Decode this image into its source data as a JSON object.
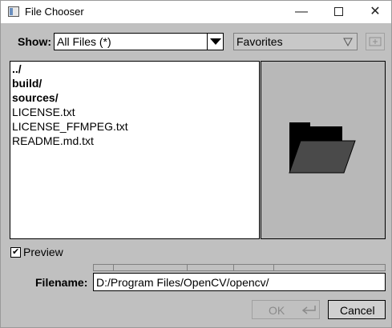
{
  "window": {
    "title": "File Chooser",
    "minimize": "—",
    "close": "✕"
  },
  "filter": {
    "label": "Show:",
    "value": "All Files (*)"
  },
  "favorites": {
    "value": "Favorites"
  },
  "files": [
    {
      "name": "../",
      "is_dir": true
    },
    {
      "name": "build/",
      "is_dir": true
    },
    {
      "name": "sources/",
      "is_dir": true
    },
    {
      "name": "LICENSE.txt",
      "is_dir": false
    },
    {
      "name": "LICENSE_FFMPEG.txt",
      "is_dir": false
    },
    {
      "name": "README.md.txt",
      "is_dir": false
    }
  ],
  "preview": {
    "label": "Preview",
    "checked": true,
    "icon": "folder-icon"
  },
  "filename": {
    "label": "Filename:",
    "value": "D:/Program Files/OpenCV/opencv/"
  },
  "buttons": {
    "ok": "OK",
    "cancel": "Cancel"
  }
}
